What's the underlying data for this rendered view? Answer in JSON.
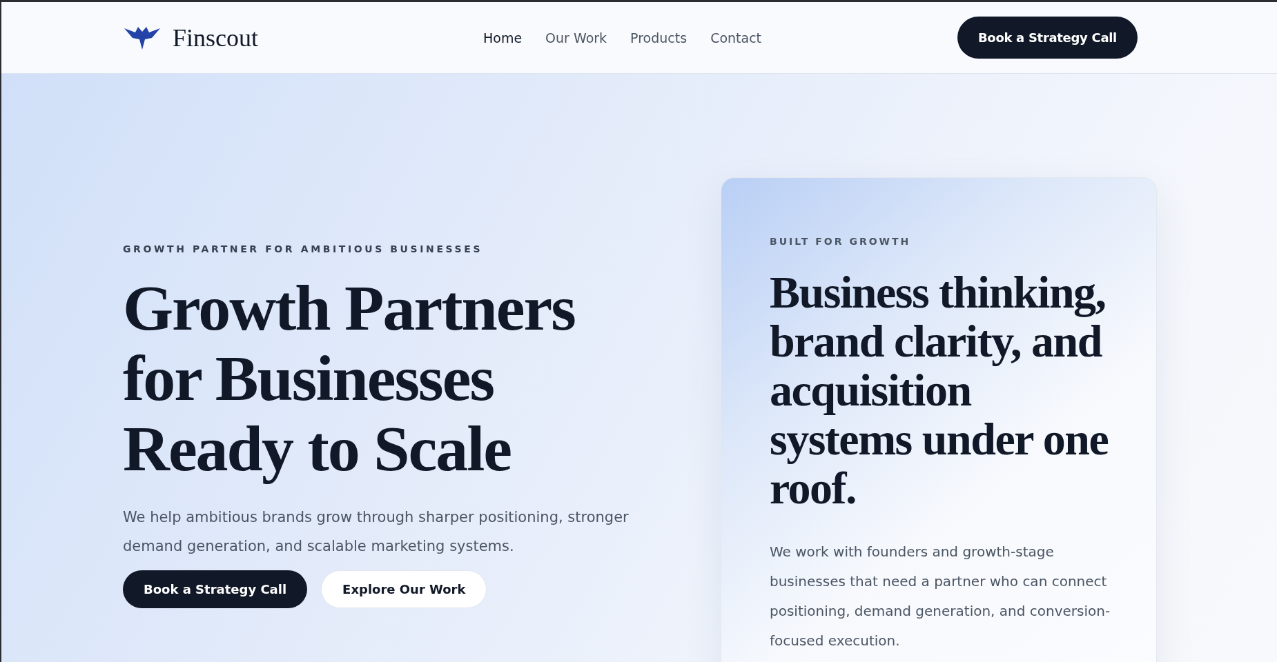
{
  "header": {
    "brand": "Finscout",
    "nav": [
      {
        "label": "Home",
        "selected": true
      },
      {
        "label": "Our Work",
        "selected": false
      },
      {
        "label": "Products",
        "selected": false
      },
      {
        "label": "Contact",
        "selected": false
      }
    ],
    "cta": "Book a Strategy Call"
  },
  "hero": {
    "eyebrow": "GROWTH PARTNER FOR AMBITIOUS BUSINESSES",
    "headline": [
      "Growth Partners",
      "for Businesses",
      "Ready to Scale"
    ],
    "text": "We help ambitious brands grow through sharper positioning, stronger demand generation, and scalable marketing systems.",
    "buttons": [
      {
        "label": "Book a Strategy Call",
        "kind": "primary"
      },
      {
        "label": "Explore Our Work",
        "kind": "secondary"
      }
    ]
  },
  "card": {
    "eyebrow": "BUILT FOR GROWTH",
    "headline": "Business thinking, brand clarity, and acquisition systems under one roof.",
    "text": "We work with founders and growth-stage businesses that need a partner who can connect positioning, demand generation, and conversion-focused execution."
  }
}
